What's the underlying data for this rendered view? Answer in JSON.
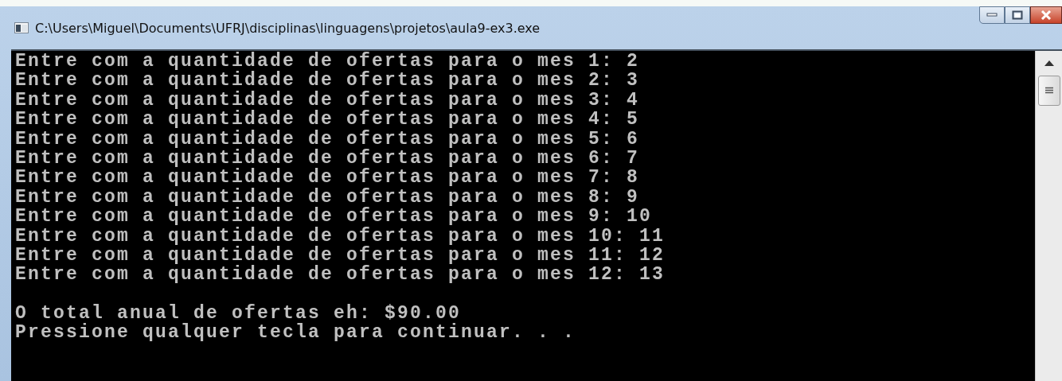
{
  "window": {
    "title": "C:\\Users\\Miguel\\Documents\\UFRJ\\disciplinas\\linguagens\\projetos\\aula9-ex3.exe"
  },
  "console": {
    "lines": [
      "Entre com a quantidade de ofertas para o mes 1: 2",
      "Entre com a quantidade de ofertas para o mes 2: 3",
      "Entre com a quantidade de ofertas para o mes 3: 4",
      "Entre com a quantidade de ofertas para o mes 4: 5",
      "Entre com a quantidade de ofertas para o mes 5: 6",
      "Entre com a quantidade de ofertas para o mes 6: 7",
      "Entre com a quantidade de ofertas para o mes 7: 8",
      "Entre com a quantidade de ofertas para o mes 8: 9",
      "Entre com a quantidade de ofertas para o mes 9: 10",
      "Entre com a quantidade de ofertas para o mes 10: 11",
      "Entre com a quantidade de ofertas para o mes 11: 12",
      "Entre com a quantidade de ofertas para o mes 12: 13"
    ],
    "summary": [
      "O total anual de ofertas eh: $90.00",
      "Pressione qualquer tecla para continuar. . ."
    ]
  }
}
